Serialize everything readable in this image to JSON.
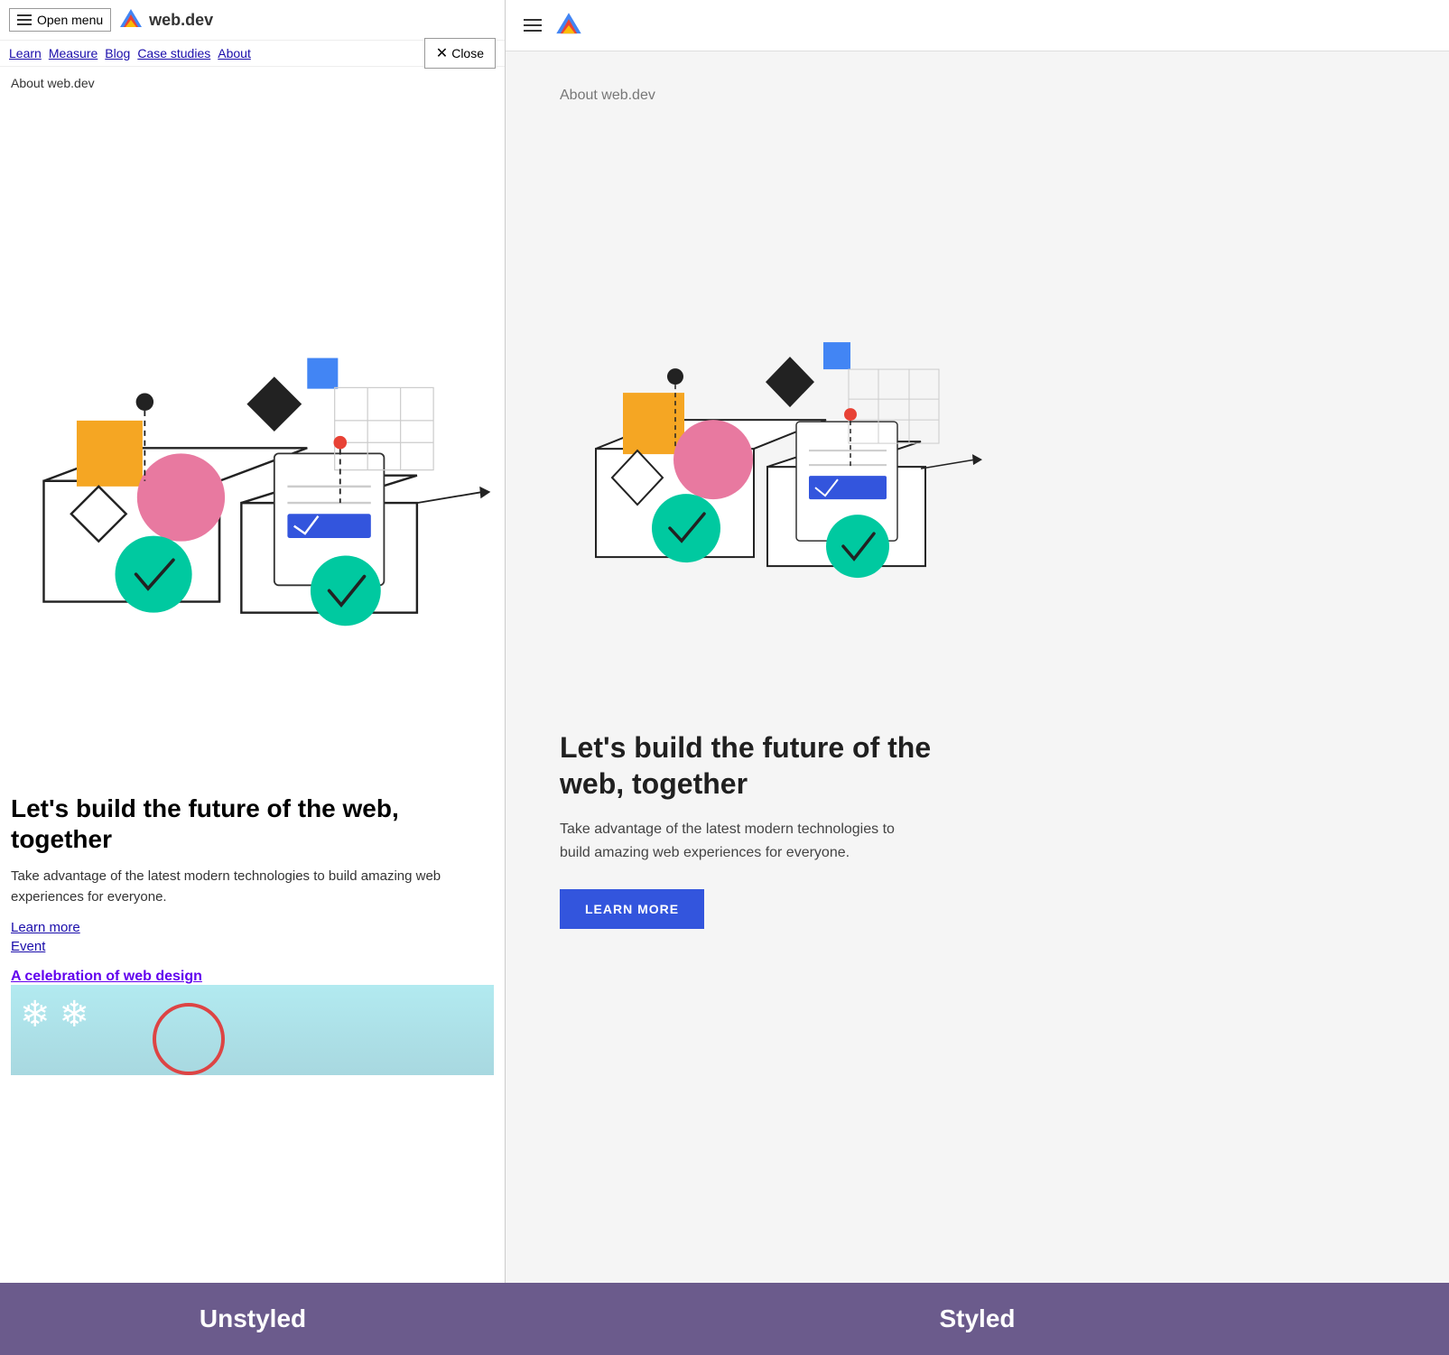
{
  "left": {
    "header": {
      "open_menu_label": "Open menu",
      "logo_text": "web.dev"
    },
    "nav": {
      "links": [
        "Learn",
        "Measure",
        "Blog",
        "Case studies",
        "About"
      ],
      "close_label": "Close"
    },
    "about_label": "About web.dev",
    "hero_title": "Let's build the future of the web, together",
    "hero_desc": "Take advantage of the latest modern technologies to build amazing web experiences for everyone.",
    "link_learn_more": "Learn more",
    "link_event": "Event",
    "celebration_link": "A celebration of web design",
    "label": "Unstyled"
  },
  "right": {
    "about_label": "About web.dev",
    "hero_title": "Let's build the future of the web, together",
    "hero_desc": "Take advantage of the latest modern technologies to build amazing web experiences for everyone.",
    "learn_more_btn": "LEARN MORE",
    "label": "Styled"
  }
}
